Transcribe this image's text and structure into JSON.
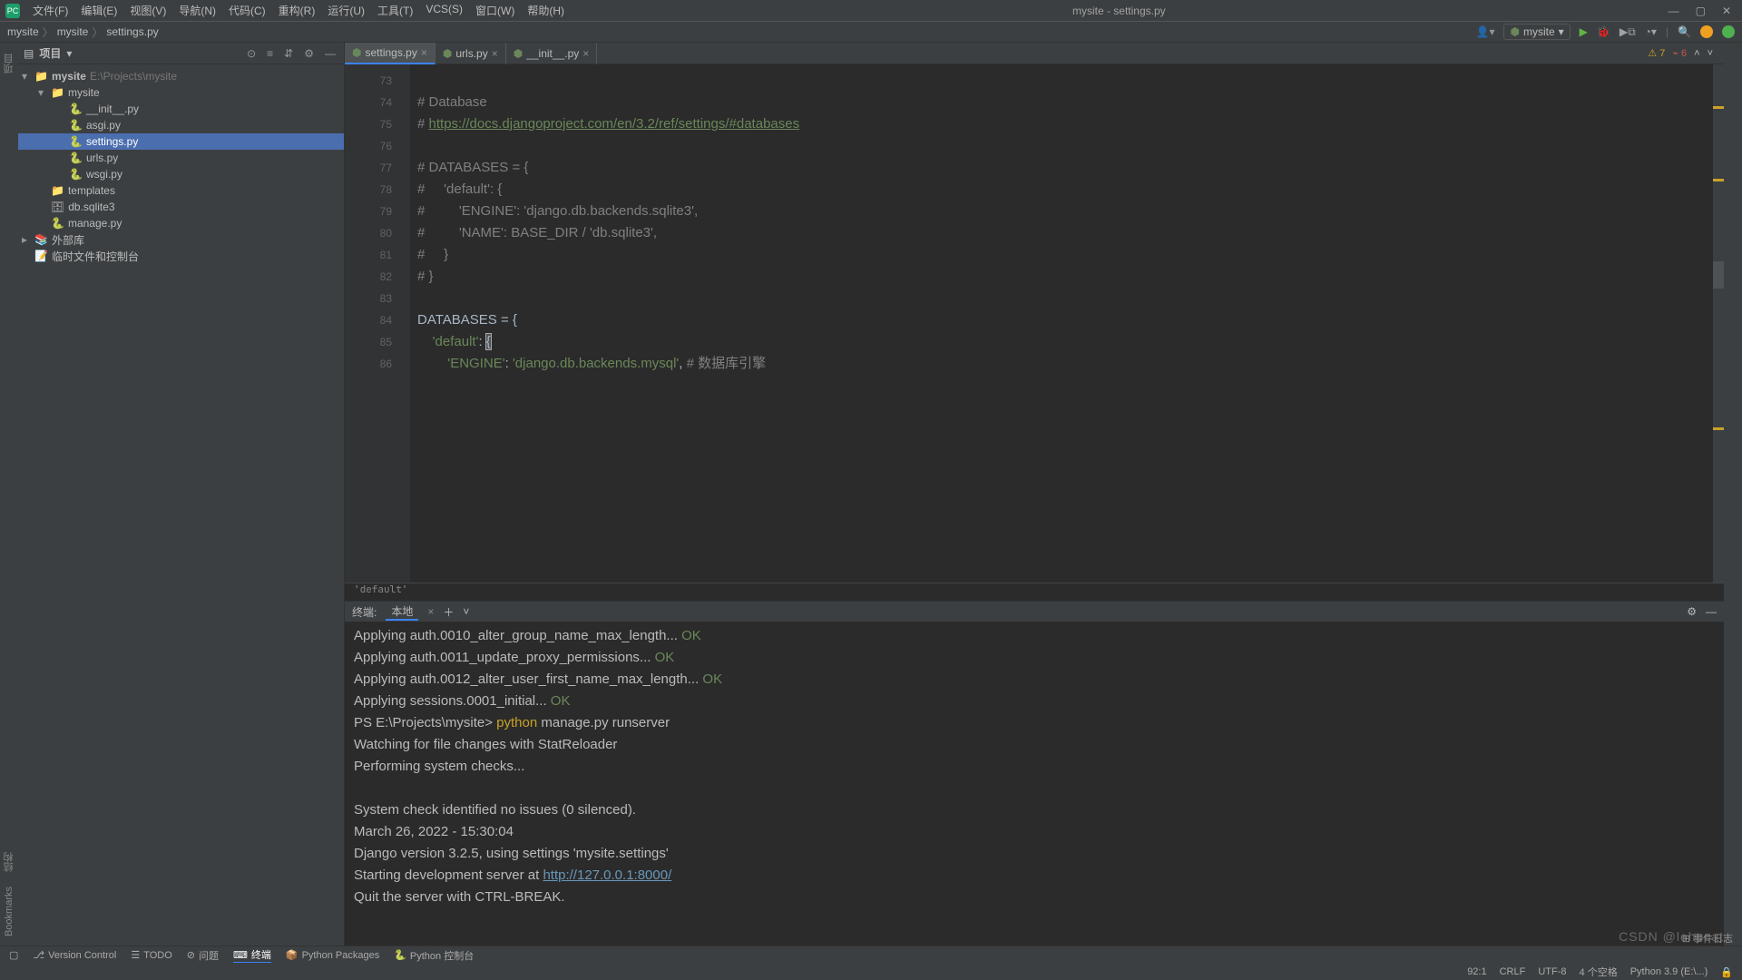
{
  "window": {
    "title": "mysite - settings.py"
  },
  "menu": [
    "文件(F)",
    "编辑(E)",
    "视图(V)",
    "导航(N)",
    "代码(C)",
    "重构(R)",
    "运行(U)",
    "工具(T)",
    "VCS(S)",
    "窗口(W)",
    "帮助(H)"
  ],
  "breadcrumb": [
    "mysite",
    "mysite",
    "settings.py"
  ],
  "run_config": {
    "label": "mysite"
  },
  "project_panel": {
    "title": "项目",
    "root": {
      "name": "mysite",
      "hint": "E:\\Projects\\mysite"
    },
    "tree": [
      {
        "indent": 1,
        "chev": "▾",
        "icon": "folder",
        "name": "mysite"
      },
      {
        "indent": 2,
        "chev": "",
        "icon": "py",
        "name": "__init__.py"
      },
      {
        "indent": 2,
        "chev": "",
        "icon": "py",
        "name": "asgi.py"
      },
      {
        "indent": 2,
        "chev": "",
        "icon": "py",
        "name": "settings.py",
        "selected": true
      },
      {
        "indent": 2,
        "chev": "",
        "icon": "py",
        "name": "urls.py"
      },
      {
        "indent": 2,
        "chev": "",
        "icon": "py",
        "name": "wsgi.py"
      },
      {
        "indent": 1,
        "chev": "",
        "icon": "folder",
        "name": "templates"
      },
      {
        "indent": 1,
        "chev": "",
        "icon": "db",
        "name": "db.sqlite3"
      },
      {
        "indent": 1,
        "chev": "",
        "icon": "py",
        "name": "manage.py"
      },
      {
        "indent": 0,
        "chev": "▸",
        "icon": "lib",
        "name": "外部库"
      },
      {
        "indent": 0,
        "chev": "",
        "icon": "scratch",
        "name": "临时文件和控制台"
      }
    ]
  },
  "tabs": [
    {
      "name": "settings.py",
      "active": true
    },
    {
      "name": "urls.py",
      "active": false
    },
    {
      "name": "__init__.py",
      "active": false
    }
  ],
  "analysis": {
    "warnings": "7",
    "weak": "6"
  },
  "gutter_start": 73,
  "code_lines": [
    {
      "n": 73,
      "html": ""
    },
    {
      "n": 74,
      "html": "<span class='comment'># Database</span>"
    },
    {
      "n": 75,
      "html": "<span class='comment'># </span><span class='link'>https://docs.djangoproject.com/en/3.2/ref/settings/#databases</span>"
    },
    {
      "n": 76,
      "html": ""
    },
    {
      "n": 77,
      "html": "<span class='comment'># DATABASES = {</span>"
    },
    {
      "n": 78,
      "html": "<span class='comment'>#     'default': {</span>"
    },
    {
      "n": 79,
      "html": "<span class='comment'>#         'ENGINE': 'django.db.backends.sqlite3',</span>"
    },
    {
      "n": 80,
      "html": "<span class='comment'>#         'NAME': BASE_DIR / 'db.sqlite3',</span>"
    },
    {
      "n": 81,
      "html": "<span class='comment'>#     }</span>"
    },
    {
      "n": 82,
      "html": "<span class='comment'># }</span>"
    },
    {
      "n": 83,
      "html": ""
    },
    {
      "n": 84,
      "html": "<span class='ident'>DATABASES = </span><span class='ident'>{</span>"
    },
    {
      "n": 85,
      "html": "    <span class='string'>'default'</span><span class='ident'>: </span><span class='ident caret'>{</span>"
    },
    {
      "n": 86,
      "html": "        <span class='string'>'ENGINE'</span><span class='ident'>: </span><span class='string'>'django.db.backends.mysql'</span><span class='ident'>, </span><span class='comment'># 数据库引擎</span>"
    }
  ],
  "breadcrumb_code": "'default'",
  "terminal": {
    "title": "终端:",
    "tab": "本地",
    "lines": [
      {
        "t": "  Applying auth.0010_alter_group_name_max_length... ",
        "ok": "OK"
      },
      {
        "t": "  Applying auth.0011_update_proxy_permissions... ",
        "ok": "OK"
      },
      {
        "t": "  Applying auth.0012_alter_user_first_name_max_length... ",
        "ok": "OK"
      },
      {
        "t": "  Applying sessions.0001_initial... ",
        "ok": "OK"
      },
      {
        "prompt": "PS E:\\Projects\\mysite> ",
        "cmd": "python",
        "rest": " manage.py runserver"
      },
      {
        "t": "Watching for file changes with StatReloader"
      },
      {
        "t": "Performing system checks..."
      },
      {
        "t": ""
      },
      {
        "t": "System check identified no issues (0 silenced)."
      },
      {
        "t": "March 26, 2022 - 15:30:04"
      },
      {
        "t": "Django version 3.2.5, using settings 'mysite.settings'"
      },
      {
        "t": "Starting development server at ",
        "url": "http://127.0.0.1:8000/"
      },
      {
        "t": "Quit the server with CTRL-BREAK."
      }
    ]
  },
  "bottom_tools": [
    "Version Control",
    "TODO",
    "问题",
    "终端",
    "Python Packages",
    "Python 控制台"
  ],
  "bottom_active": "终端",
  "event_log": "事件日志",
  "status": {
    "pos": "92:1",
    "eol": "CRLF",
    "enc": "UTF-8",
    "indent": "4 个空格",
    "python": "Python 3.9 (E:\\...)"
  },
  "watermark": "CSDN @lehocat"
}
